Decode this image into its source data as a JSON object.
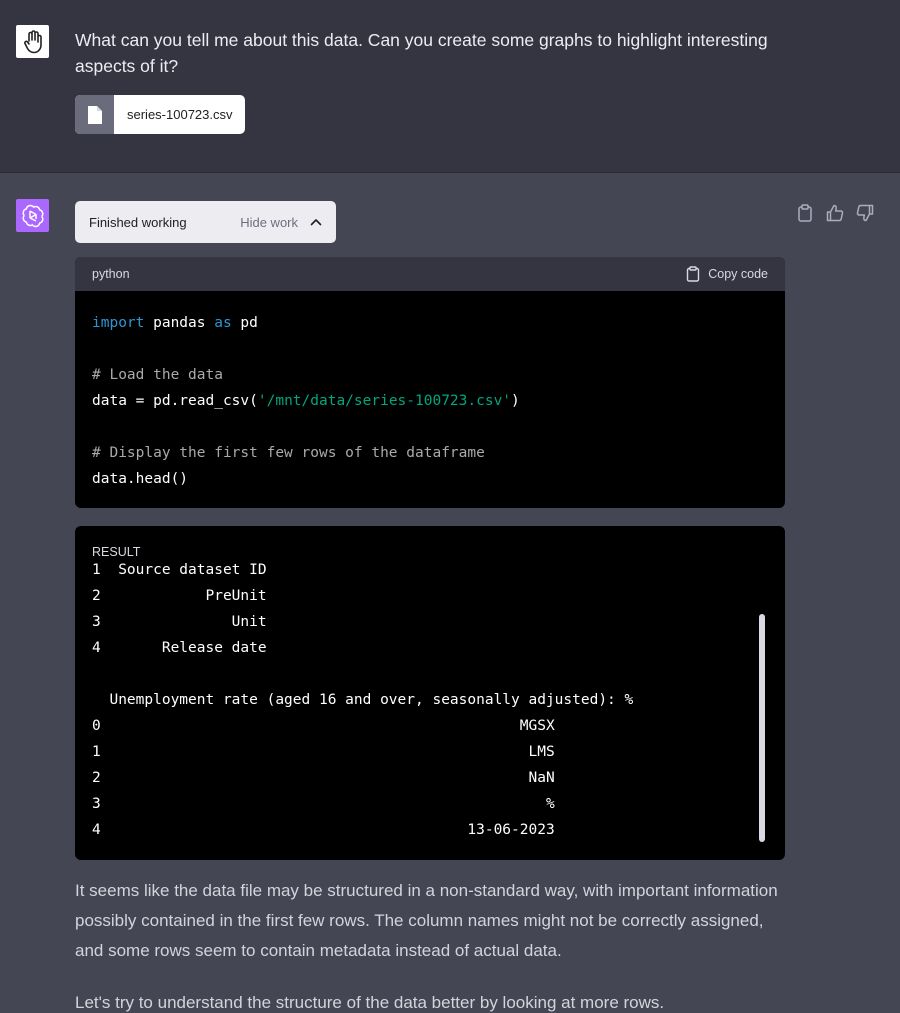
{
  "user": {
    "message": "What can you tell me about this data. Can you create some graphs to highlight interesting aspects of it?",
    "attachment": {
      "file_name": "series-100723.csv",
      "icon": "file-icon"
    },
    "avatar_icon": "hand-icon"
  },
  "assistant": {
    "avatar_icon": "openai-logo-icon",
    "work_toggle": {
      "status": "Finished working",
      "action": "Hide work",
      "icon": "chevron-up-icon"
    },
    "actions": [
      "clipboard-icon",
      "thumbs-up-icon",
      "thumbs-down-icon"
    ],
    "code": {
      "language": "python",
      "copy_label": "Copy code",
      "lines": {
        "l1_kw1": "import",
        "l1_mid": " pandas ",
        "l1_kw2": "as",
        "l1_end": " pd",
        "l2": "# Load the data",
        "l3_start": "data = pd.read_csv(",
        "l3_str": "'/mnt/data/series-100723.csv'",
        "l3_end": ")",
        "l4": "# Display the first few rows of the dataframe",
        "l5": "data.head()"
      }
    },
    "result": {
      "label": "RESULT",
      "rows_top": [
        "1  Source dataset ID",
        "2            PreUnit",
        "3               Unit",
        "4       Release date"
      ],
      "column_header": "  Unemployment rate (aged 16 and over, seasonally adjusted): %",
      "rows_bottom": [
        "0                                                MGSX",
        "1                                                 LMS",
        "2                                                 NaN",
        "3                                                   %",
        "4                                          13-06-2023"
      ]
    },
    "answer": {
      "p1": "It seems like the data file may be structured in a non-standard way, with important information possibly contained in the first few rows. The column names might not be correctly assigned, and some rows seem to contain metadata instead of actual data.",
      "p2": "Let's try to understand the structure of the data better by looking at more rows."
    }
  },
  "colors": {
    "bg_user": "#343541",
    "bg_assistant": "#444654",
    "bot_avatar": "#ab68ff",
    "code_bg": "#000000",
    "keyword": "#2e95d3",
    "string": "#00a67d"
  }
}
